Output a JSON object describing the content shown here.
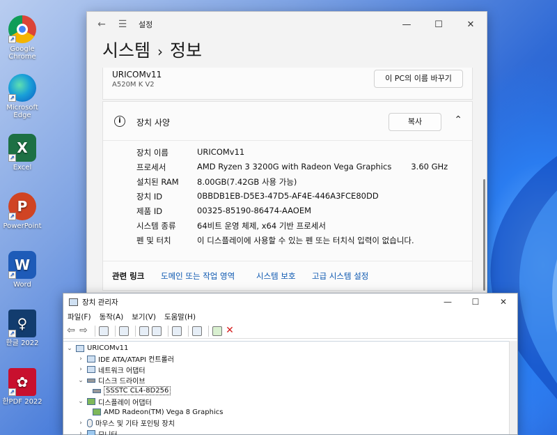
{
  "desktop": {
    "icons": [
      {
        "label": "Google Chrome",
        "icon": "chrome-icon"
      },
      {
        "label": "Microsoft Edge",
        "icon": "edge-icon"
      },
      {
        "label": "Excel",
        "icon": "excel-icon"
      },
      {
        "label": "PowerPoint",
        "icon": "powerpoint-icon"
      },
      {
        "label": "Word",
        "icon": "word-icon"
      },
      {
        "label": "한글 2022",
        "icon": "hangul-icon"
      },
      {
        "label": "한PDF 2022",
        "icon": "hanpdf-icon"
      }
    ],
    "icon_glyphs": {
      "excel": "X",
      "powerpoint": "P",
      "word": "W",
      "hangul": "♀",
      "hanpdf": "✿",
      "shortcut": "↗"
    }
  },
  "settings": {
    "app_title": "설정",
    "back_glyph": "←",
    "menu_glyph": "☰",
    "controls": {
      "minimize": "—",
      "maximize": "☐",
      "close": "✕"
    },
    "breadcrumb": {
      "parent": "시스템",
      "separator": "›",
      "current": "정보"
    },
    "pc": {
      "name": "URICOMv11",
      "model": "A520M K V2",
      "rename_label": "이 PC의 이름 바꾸기"
    },
    "spec": {
      "title": "장치 사양",
      "info_glyph": "i",
      "copy_label": "복사",
      "collapse_glyph": "⌃",
      "rows": [
        {
          "key": "장치 이름",
          "value": "URICOMv11",
          "extra": ""
        },
        {
          "key": "프로세서",
          "value": "AMD Ryzen 3 3200G with Radeon Vega Graphics",
          "extra": "3.60 GHz"
        },
        {
          "key": "설치된 RAM",
          "value": "8.00GB(7.42GB 사용 가능)",
          "extra": ""
        },
        {
          "key": "장치 ID",
          "value": "0BBDB1EB-D5E3-47D5-AF4E-446A3FCE80DD",
          "extra": ""
        },
        {
          "key": "제품 ID",
          "value": "00325-85190-86474-AAOEM",
          "extra": ""
        },
        {
          "key": "시스템 종류",
          "value": "64비트 운영 체제, x64 기반 프로세서",
          "extra": ""
        },
        {
          "key": "펜 및 터치",
          "value": "이 디스플레이에 사용할 수 있는 펜 또는 터치식 입력이 없습니다.",
          "extra": ""
        }
      ]
    },
    "related": {
      "label": "관련 링크",
      "links": [
        "도메인 또는 작업 영역",
        "시스템 보호",
        "고급 시스템 설정"
      ]
    }
  },
  "device_manager": {
    "title": "장치 관리자",
    "controls": {
      "minimize": "—",
      "maximize": "☐",
      "close": "✕"
    },
    "menu": [
      "파일(F)",
      "동작(A)",
      "보기(V)",
      "도움말(H)"
    ],
    "toolbar": {
      "back": "⇦",
      "forward": "⇨",
      "delete": "✕"
    },
    "tree": [
      {
        "label": "URICOMv11",
        "expander": "⌄",
        "indent": 0
      },
      {
        "label": "IDE ATA/ATAPI 컨트롤러",
        "expander": "›",
        "indent": 1
      },
      {
        "label": "네트워크 어댑터",
        "expander": "›",
        "indent": 1
      },
      {
        "label": "디스크 드라이브",
        "expander": "⌄",
        "indent": 1
      },
      {
        "label": "SSSTC CL4-8D256",
        "expander": "",
        "indent": 2,
        "selected": true
      },
      {
        "label": "디스플레이 어댑터",
        "expander": "⌄",
        "indent": 1
      },
      {
        "label": "AMD Radeon(TM) Vega 8 Graphics",
        "expander": "",
        "indent": 2
      },
      {
        "label": "마우스 및 기타 포인팅 장치",
        "expander": "›",
        "indent": 1
      },
      {
        "label": "모니터",
        "expander": "›",
        "indent": 1
      }
    ]
  }
}
